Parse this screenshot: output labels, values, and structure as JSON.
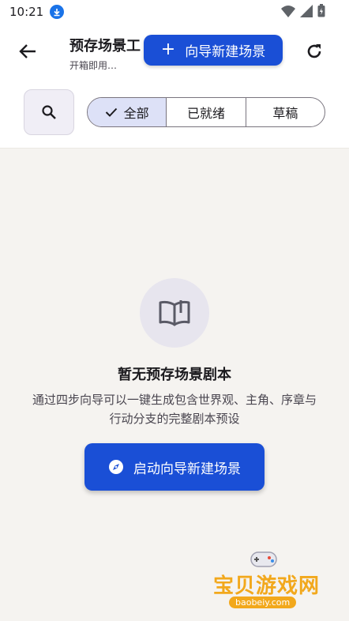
{
  "statusbar": {
    "time": "10:21"
  },
  "appbar": {
    "title": "预存场景工",
    "subtitle": "开箱即用…",
    "wizard_button": "向导新建场景"
  },
  "filters": {
    "segments": [
      "全部",
      "已就绪",
      "草稿"
    ],
    "selected": "全部"
  },
  "empty_state": {
    "title": "暂无预存场景剧本",
    "description": "通过四步向导可以一键生成包含世界观、主角、序章与行动分支的完整剧本预设",
    "button": "启动向导新建场景"
  },
  "watermark": {
    "text": "宝贝游戏网",
    "url": "baobeiy.com"
  },
  "colors": {
    "primary": "#1a4fd6",
    "segment_active": "#dde1f7",
    "background": "#f5f3f0"
  }
}
